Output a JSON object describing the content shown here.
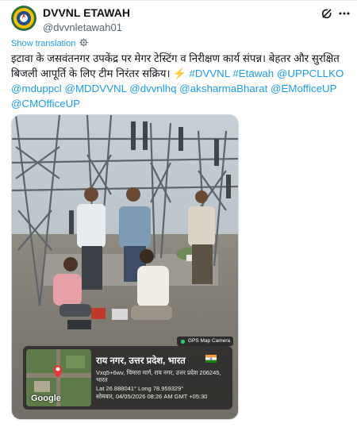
{
  "account": {
    "display_name": "DVVNL ETAWAH",
    "handle": "@dvvnletawah01"
  },
  "translate": {
    "label": "Show translation"
  },
  "tweet": {
    "text_plain": "इटावा के जसवंतनगर उपकेंद्र पर मेगर टेस्टिंग व निरीक्षण कार्य संपन्न। बेहतर और सुरक्षित बिजली आपूर्ति के लिए टीम निरंतर सक्रिय। ⚡ ",
    "hashtags": [
      "#DVVNL",
      "#Etawah"
    ],
    "mentions": [
      "@UPPCLLKO",
      "@mduppcl",
      "@MDDVVNL",
      "@dvvnlhq",
      "@aksharmaBharat",
      "@EMofficeUP",
      "@CMOfficeUP"
    ]
  },
  "gps_overlay": {
    "badge": "GPS Map Camera",
    "title": "राय नगर, उत्तर प्रदेश, भारत",
    "address": "Vxq5+6wv, चिमारा मार्ग, राय नगर, उत्तर प्रदेश 206245, भारत",
    "coords": "Lat 26.888041° Long 78.959329°",
    "timestamp": "सोमवार, 04/05/2026 08:26 AM GMT +05:30",
    "map_label": "Google"
  },
  "icons": {
    "grok": "grok-icon",
    "more": "more-icon",
    "translate": "translate-gear-icon"
  },
  "colors": {
    "link": "#1d9bf0",
    "text": "#0f1419",
    "muted": "#536471"
  }
}
